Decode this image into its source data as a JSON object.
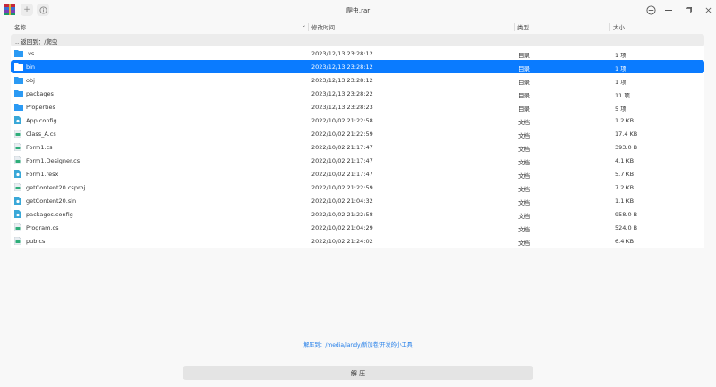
{
  "window": {
    "title": "爬虫.rar"
  },
  "columns": {
    "name": "名称",
    "modified": "修改时间",
    "type": "类型",
    "size": "大小"
  },
  "back_row": {
    "label": ".. 返回到：/爬虫"
  },
  "files": [
    {
      "name": ".vs",
      "modified": "2023/12/13 23:28:12",
      "type": "目录",
      "size": "1 项",
      "icon": "folder-icon"
    },
    {
      "name": "bin",
      "modified": "2023/12/13 23:28:12",
      "type": "目录",
      "size": "1 项",
      "icon": "folder-icon",
      "selected": true
    },
    {
      "name": "obj",
      "modified": "2023/12/13 23:28:12",
      "type": "目录",
      "size": "1 项",
      "icon": "folder-icon"
    },
    {
      "name": "packages",
      "modified": "2023/12/13 23:28:22",
      "type": "目录",
      "size": "11 项",
      "icon": "folder-icon"
    },
    {
      "name": "Properties",
      "modified": "2023/12/13 23:28:23",
      "type": "目录",
      "size": "5 项",
      "icon": "folder-icon"
    },
    {
      "name": "App.config",
      "modified": "2022/10/02 21:22:58",
      "type": "文档",
      "size": "1.2 KB",
      "icon": "config-file-icon"
    },
    {
      "name": "Class_A.cs",
      "modified": "2022/10/02 21:22:59",
      "type": "文档",
      "size": "17.4 KB",
      "icon": "code-file-icon"
    },
    {
      "name": "Form1.cs",
      "modified": "2022/10/02 21:17:47",
      "type": "文档",
      "size": "393.0 B",
      "icon": "code-file-icon"
    },
    {
      "name": "Form1.Designer.cs",
      "modified": "2022/10/02 21:17:47",
      "type": "文档",
      "size": "4.1 KB",
      "icon": "code-file-icon"
    },
    {
      "name": "Form1.resx",
      "modified": "2022/10/02 21:17:47",
      "type": "文档",
      "size": "5.7 KB",
      "icon": "config-file-icon"
    },
    {
      "name": "getContent20.csproj",
      "modified": "2022/10/02 21:22:59",
      "type": "文档",
      "size": "7.2 KB",
      "icon": "code-file-icon"
    },
    {
      "name": "getContent20.sln",
      "modified": "2022/10/02 21:04:32",
      "type": "文档",
      "size": "1.1 KB",
      "icon": "config-file-icon"
    },
    {
      "name": "packages.config",
      "modified": "2022/10/02 21:22:58",
      "type": "文档",
      "size": "958.0 B",
      "icon": "config-file-icon"
    },
    {
      "name": "Program.cs",
      "modified": "2022/10/02 21:04:29",
      "type": "文档",
      "size": "524.0 B",
      "icon": "code-file-icon"
    },
    {
      "name": "pub.cs",
      "modified": "2022/10/02 21:24:02",
      "type": "文档",
      "size": "6.4 KB",
      "icon": "code-file-icon"
    }
  ],
  "footer": {
    "extract_path": "解压到：/media/landy/新加卷/开发的小工具",
    "extract_button": "解 压"
  },
  "colors": {
    "accent": "#0a7bff",
    "folder": "#2b9af3",
    "link": "#1e7be8"
  }
}
